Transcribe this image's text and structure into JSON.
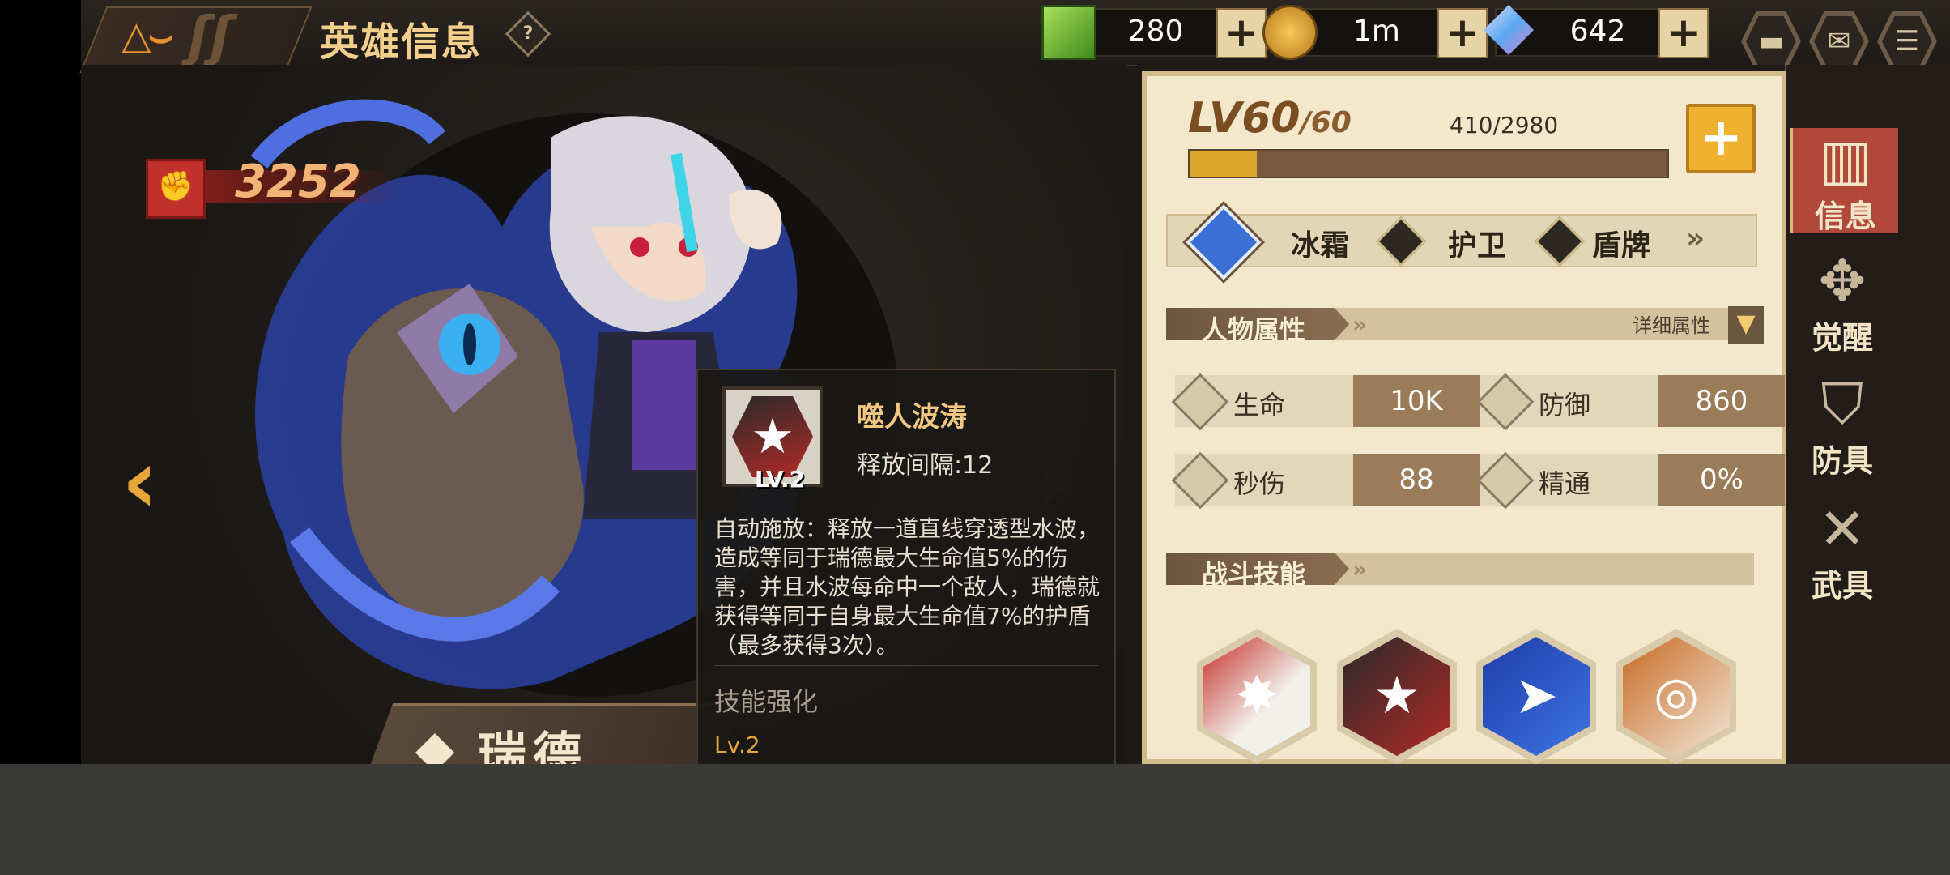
{
  "header": {
    "title": "英雄信息",
    "help_icon": "?"
  },
  "resources": [
    {
      "name": "green-cube",
      "value": "280",
      "plus": "+"
    },
    {
      "name": "gold-coin",
      "value": "1m",
      "plus": "+"
    },
    {
      "name": "crystal",
      "value": "642",
      "plus": "+"
    }
  ],
  "top_buttons": [
    "chat-icon",
    "mail-icon",
    "menu-icon"
  ],
  "hero": {
    "power": "3252",
    "name": "瑞德"
  },
  "skill_tooltip": {
    "name": "噬人波涛",
    "level": "LV.2",
    "interval": "释放间隔:12",
    "description": "自动施放：释放一道直线穿透型水波，造成等同于瑞德最大生命值5%的伤害，并且水波每命中一个敌人，瑞德就获得等同于自身最大生命值7%的护盾（最多获得3次）。",
    "upgrade_title": "技能强化",
    "upgrade_level": "Lv.2"
  },
  "level": {
    "current": "LV60",
    "max": "/60",
    "exp": "410/2980",
    "exp_progress": 0.14,
    "plus": "+"
  },
  "tags": [
    "冰霜",
    "护卫",
    "盾牌"
  ],
  "attributes_section": {
    "title": "人物属性",
    "detail_label": "详细属性",
    "items": [
      {
        "name": "生命",
        "value": "10K"
      },
      {
        "name": "防御",
        "value": "860"
      },
      {
        "name": "秒伤",
        "value": "88"
      },
      {
        "name": "精通",
        "value": "0%"
      }
    ]
  },
  "skills_section": {
    "title": "战斗技能",
    "skills": [
      "explosion-skill",
      "wave-skill",
      "dash-skill",
      "drill-skill"
    ]
  },
  "side_tabs": [
    {
      "label": "信息",
      "active": true
    },
    {
      "label": "觉醒",
      "active": false
    },
    {
      "label": "防具",
      "active": false
    },
    {
      "label": "武具",
      "active": false
    }
  ],
  "colors": {
    "accent_gold": "#f0b030",
    "parchment": "#f3e8cc",
    "tooltip_title": "#f0c682"
  }
}
